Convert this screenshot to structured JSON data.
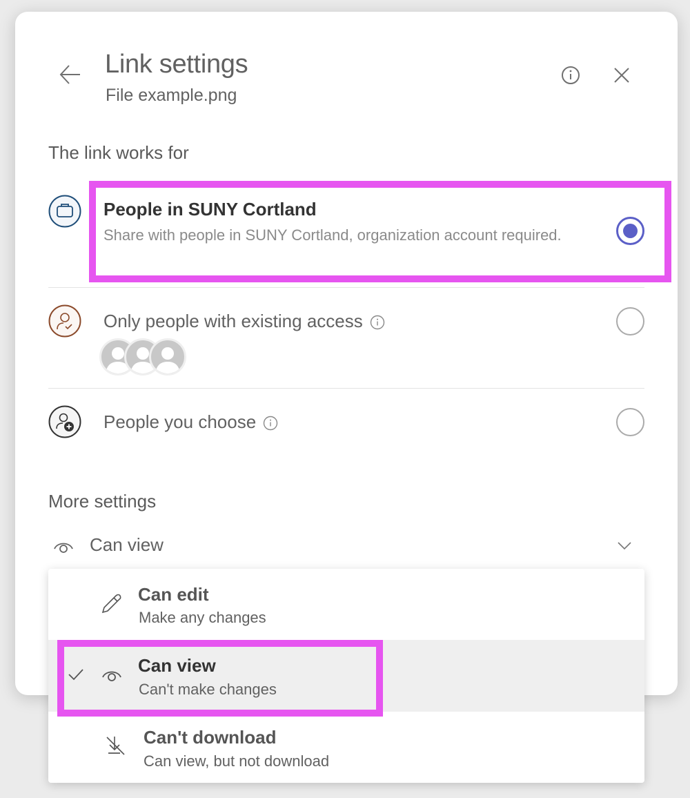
{
  "header": {
    "title": "Link settings",
    "subtitle": "File example.png",
    "back_icon": "arrow-left-icon",
    "info_icon": "info-icon",
    "close_icon": "close-icon"
  },
  "link_works_for": {
    "label": "The link works for",
    "options": [
      {
        "title": "People in SUNY Cortland",
        "description": "Share with people in SUNY Cortland, organization account required.",
        "icon": "briefcase-icon",
        "selected": true
      },
      {
        "title": "Only people with existing access",
        "icon": "person-check-icon",
        "has_info": true,
        "avatar_count": 3,
        "selected": false
      },
      {
        "title": "People you choose",
        "icon": "person-add-icon",
        "has_info": true,
        "selected": false
      }
    ]
  },
  "more_settings": {
    "label": "More settings",
    "permission_dropdown": {
      "selected": "Can view",
      "icon": "eye-icon",
      "options": [
        {
          "title": "Can edit",
          "description": "Make any changes",
          "icon": "pencil-icon",
          "checked": false
        },
        {
          "title": "Can view",
          "description": "Can't make changes",
          "icon": "eye-icon",
          "checked": true
        },
        {
          "title": "Can't download",
          "description": "Can view, but not download",
          "icon": "no-download-icon",
          "checked": false
        }
      ]
    }
  },
  "colors": {
    "accent": "#5b5fc7",
    "highlight": "#e655f0",
    "briefcase_ring": "#1f4e79",
    "person_check_ring": "#8b4a2b",
    "selected_row_bg": "#efefef"
  }
}
